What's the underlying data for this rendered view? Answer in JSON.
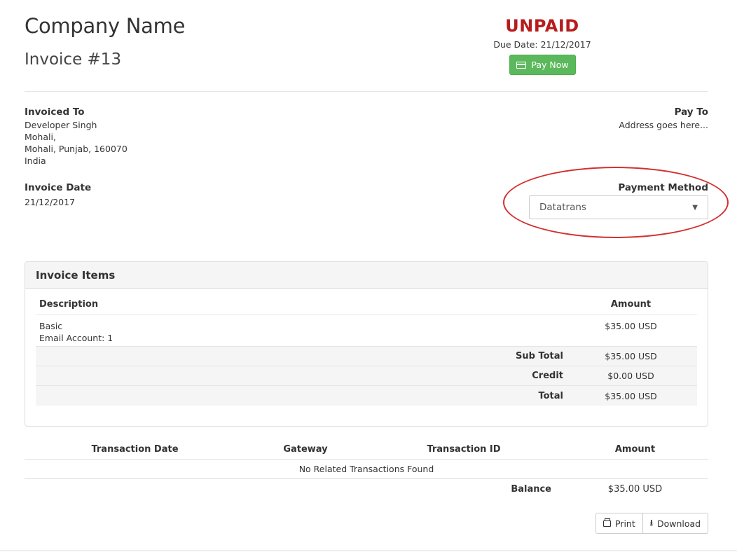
{
  "header": {
    "company_name": "Company Name",
    "invoice_number": "Invoice #13",
    "status": "UNPAID",
    "due_date": "Due Date: 21/12/2017",
    "pay_now_label": "Pay Now"
  },
  "invoiced_to": {
    "label": "Invoiced To",
    "lines": [
      "Developer Singh",
      "Mohali,",
      "Mohali, Punjab, 160070",
      "India"
    ]
  },
  "pay_to": {
    "label": "Pay To",
    "address": "Address goes here..."
  },
  "invoice_date": {
    "label": "Invoice Date",
    "value": "21/12/2017"
  },
  "payment_method": {
    "label": "Payment Method",
    "selected": "Datatrans"
  },
  "invoice_items": {
    "title": "Invoice Items",
    "col_description": "Description",
    "col_amount": "Amount",
    "items": [
      {
        "line1": "Basic",
        "line2": "Email Account: 1",
        "amount": "$35.00 USD"
      }
    ],
    "sub_total_label": "Sub Total",
    "sub_total": "$35.00 USD",
    "credit_label": "Credit",
    "credit": "$0.00 USD",
    "total_label": "Total",
    "total": "$35.00 USD"
  },
  "transactions": {
    "col_date": "Transaction Date",
    "col_gateway": "Gateway",
    "col_id": "Transaction ID",
    "col_amount": "Amount",
    "empty_message": "No Related Transactions Found",
    "balance_label": "Balance",
    "balance": "$35.00 USD"
  },
  "actions": {
    "print_label": "Print",
    "download_label": "Download"
  },
  "colors": {
    "unpaid": "#b71c1c",
    "pay_button": "#5cb85c",
    "highlight_ellipse": "#d32f2f"
  }
}
